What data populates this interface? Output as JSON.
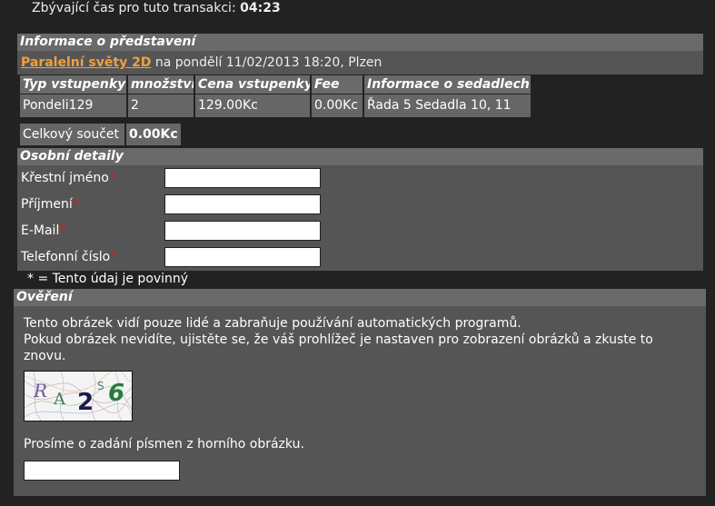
{
  "timer": {
    "label": "Zbývající čas pro tuto transakci:",
    "value": "04:23"
  },
  "performance": {
    "heading": "Informace o představení",
    "movie_title": "Paralelní světy 2D",
    "details": "na pondělí 11/02/2013 18:20, Plzen"
  },
  "tickets": {
    "headers": [
      "Typ vstupenky",
      "množství",
      "Cena vstupenky",
      "Fee",
      "Informace o sedadlech"
    ],
    "row": [
      "Pondeli129",
      "2",
      "129.00Kc",
      "0.00Kc",
      "Řada 5 Sedadla 10, 11"
    ],
    "total_label": "Celkový součet",
    "total_value": "0.00Kc"
  },
  "personal": {
    "heading": "Osobní detaily",
    "fields": [
      {
        "label": "Křestní jméno",
        "value": ""
      },
      {
        "label": "Příjmení",
        "value": ""
      },
      {
        "label": "E-Mail",
        "value": ""
      },
      {
        "label": "Telefonní číslo",
        "value": ""
      }
    ],
    "required_mark": "*",
    "required_note": "* = Tento údaj je povinný"
  },
  "verification": {
    "heading": "Ověření",
    "info_line1": "Tento obrázek vidí pouze lidé a zabraňuje používání automatických programů.",
    "info_line2": "Pokud obrázek nevidíte, ujistěte se, že váš prohlížeč je nastaven pro zobrazení obrázků a zkuste to znovu.",
    "captcha_text": "RA2S6",
    "prompt": "Prosíme o zadání písmen z horního obrázku.",
    "input_value": ""
  },
  "colors": {
    "link": "#f0a040",
    "required": "#cc2222",
    "header_bg": "#6a6a6a",
    "panel_bg": "#555555"
  }
}
